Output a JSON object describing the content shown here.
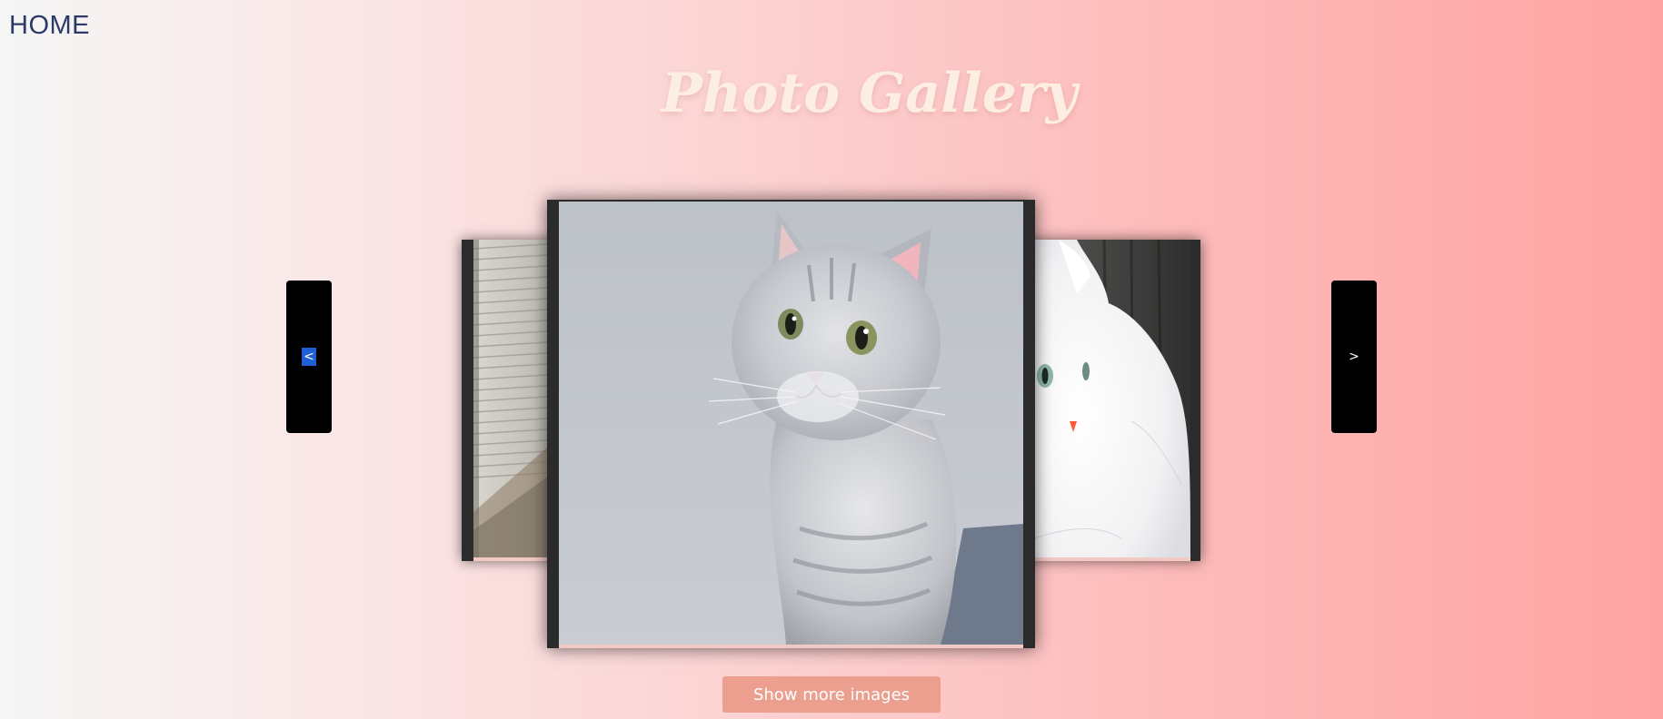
{
  "nav": {
    "home_label": "HOME"
  },
  "gallery": {
    "title": "Photo Gallery",
    "prev_label": "<",
    "next_label": ">",
    "show_more_label": "Show more images",
    "slides": [
      {
        "position": "left",
        "subject": "window-blinds-photo"
      },
      {
        "position": "center",
        "subject": "gray-tabby-cat-photo"
      },
      {
        "position": "right",
        "subject": "white-persian-cat-photo"
      }
    ]
  },
  "colors": {
    "home_text": "#2b3a67",
    "title_text": "#fdeee4",
    "nav_button_bg": "#000000",
    "show_more_bg": "#ec9f8f",
    "gradient_start": "#f6f6f6",
    "gradient_end": "#fea3a2"
  }
}
